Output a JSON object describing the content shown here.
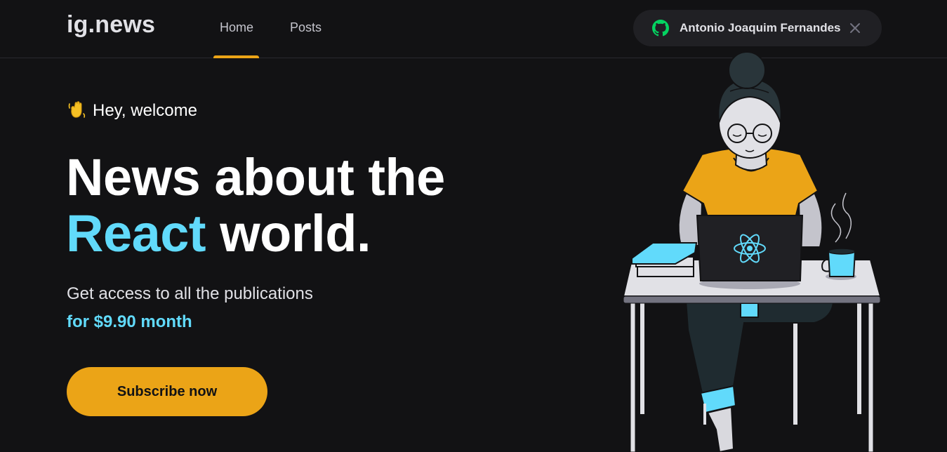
{
  "header": {
    "logo": "ig.news",
    "nav": [
      {
        "label": "Home",
        "active": true
      },
      {
        "label": "Posts",
        "active": false
      }
    ],
    "signin": {
      "user_name": "Antonio Joaquim Fernandes",
      "icon": "github-icon",
      "close_icon": "close-icon"
    }
  },
  "hero": {
    "welcome": "Hey, welcome",
    "welcome_icon": "waving-hand-icon",
    "headline_line1": "News about the",
    "headline_accent": "React",
    "headline_line2_rest": "world.",
    "subtitle": "Get access to all the publications",
    "price": "for $9.90 month",
    "cta": "Subscribe now"
  },
  "colors": {
    "background": "#121214",
    "accent_yellow": "#eba417",
    "accent_cyan": "#61dafb",
    "github_green": "#04d361",
    "text": "#e1e1e6"
  }
}
